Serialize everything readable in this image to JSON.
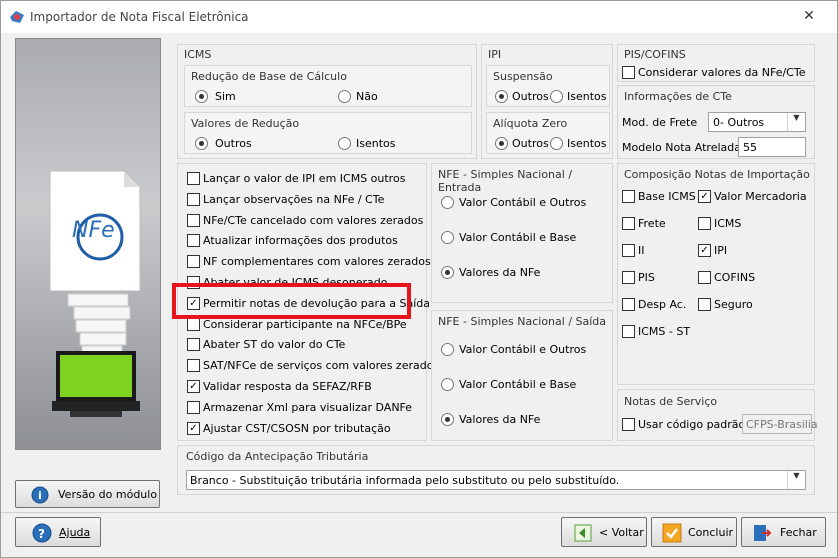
{
  "window": {
    "title": "Importador de Nota Fiscal Eletrônica",
    "close": "✕"
  },
  "side": {
    "logo_text": "NFe",
    "version_button": "Versão do módulo"
  },
  "icms": {
    "title": "ICMS",
    "reducao_base": {
      "title": "Redução de Base de Cálculo",
      "sim": "Sim",
      "nao": "Não"
    },
    "valores_reducao": {
      "title": "Valores de Redução",
      "outros": "Outros",
      "isentos": "Isentos"
    }
  },
  "ipi": {
    "title": "IPI",
    "suspensao": {
      "title": "Suspensão",
      "outros": "Outros",
      "isentos": "Isentos"
    },
    "aliquota_zero": {
      "title": "Alíquota Zero",
      "outros": "Outros",
      "isentos": "Isentos"
    }
  },
  "pis_cofins": {
    "title": "PIS/COFINS",
    "checkbox": "Considerar valores da NFe/CTe"
  },
  "cte": {
    "title": "Informações de CTe",
    "mod_frete_label": "Mod. de Frete",
    "mod_frete_value": "0- Outros",
    "nota_atrelada_label": "Modelo Nota Atrelada",
    "nota_atrelada_value": "55"
  },
  "options": [
    {
      "label": "Lançar o valor de IPI em ICMS outros",
      "checked": false
    },
    {
      "label": "Lançar observações na NFe / CTe",
      "checked": false
    },
    {
      "label": "NFe/CTe cancelado com valores zerados",
      "checked": false
    },
    {
      "label": "Atualizar informações dos produtos",
      "checked": false
    },
    {
      "label": "NF complementares com valores zerados",
      "checked": false
    },
    {
      "label": "Abater valor de ICMS desonerado",
      "checked": false
    },
    {
      "label": "Permitir notas de devolução para a Saída",
      "checked": true
    },
    {
      "label": "Considerar participante na NFCe/BPe",
      "checked": false
    },
    {
      "label": "Abater ST do valor do CTe",
      "checked": false
    },
    {
      "label": "SAT/NFCe de serviços com valores zerados",
      "checked": false
    },
    {
      "label": "Validar resposta da SEFAZ/RFB",
      "checked": true
    },
    {
      "label": "Armazenar Xml para visualizar DANFe",
      "checked": false
    },
    {
      "label": "Ajustar CST/CSOSN por tributação",
      "checked": true
    }
  ],
  "sn_entrada": {
    "title": "NFE - Simples Nacional / Entrada",
    "opts": [
      "Valor Contábil e Outros",
      "Valor Contábil e Base",
      "Valores da NFe"
    ]
  },
  "sn_saida": {
    "title": "NFE - Simples Nacional / Saída",
    "opts": [
      "Valor Contábil e Outros",
      "Valor Contábil e Base",
      "Valores da NFe"
    ]
  },
  "composicao": {
    "title": "Composição Notas de Importação",
    "items": [
      {
        "label": "Base ICMS",
        "checked": false
      },
      {
        "label": "Valor Mercadoria",
        "checked": true
      },
      {
        "label": "Frete",
        "checked": false
      },
      {
        "label": "ICMS",
        "checked": false
      },
      {
        "label": "II",
        "checked": false
      },
      {
        "label": "IPI",
        "checked": true
      },
      {
        "label": "PIS",
        "checked": false
      },
      {
        "label": "COFINS",
        "checked": false
      },
      {
        "label": "Desp Ac.",
        "checked": false
      },
      {
        "label": "Seguro",
        "checked": false
      },
      {
        "label": "ICMS - ST",
        "checked": false
      }
    ]
  },
  "servico": {
    "title": "Notas de Serviço",
    "checkbox": "Usar código padrão",
    "code": "CFPS-Brasilia"
  },
  "antecipacao": {
    "title": "Código da Antecipação Tributária",
    "value": "Branco - Substituição tributária informada pelo substituto ou pelo substituído."
  },
  "footer": {
    "ajuda": "Ajuda",
    "voltar": "< Voltar",
    "concluir": "Concluir",
    "fechar": "Fechar"
  },
  "colors": {
    "highlight": "#e8141b",
    "accent": "#2a6fb8"
  }
}
